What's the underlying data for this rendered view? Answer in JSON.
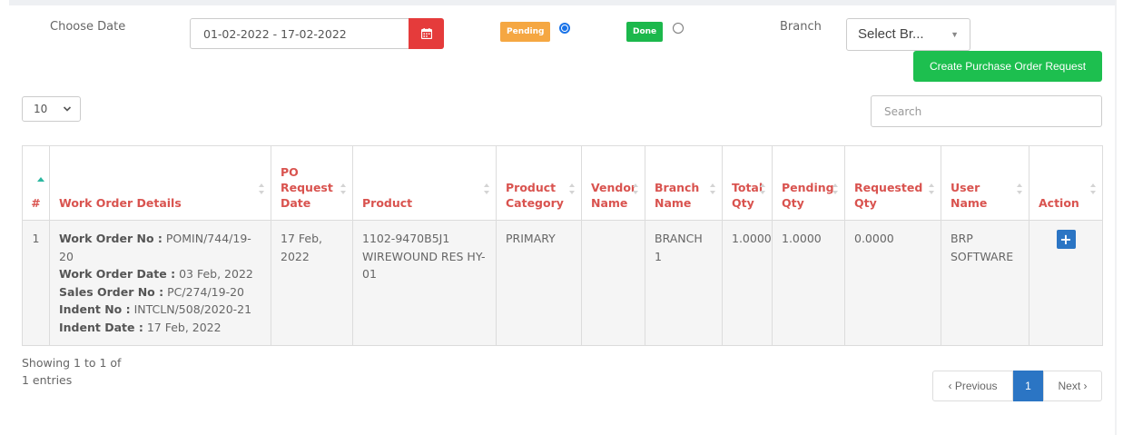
{
  "filters": {
    "date_label": "Choose Date",
    "date_range": "01-02-2022 - 17-02-2022",
    "pending_label": "Pending",
    "done_label": "Done",
    "branch_label": "Branch",
    "branch_select": "Select Br..."
  },
  "actions": {
    "create_po": "Create Purchase Order Request"
  },
  "list": {
    "page_size": "10",
    "search_placeholder": "Search"
  },
  "table": {
    "headers": {
      "idx": "#",
      "work_order_details": "Work Order Details",
      "po_request_date": "PO Request Date",
      "product": "Product",
      "product_category": "Product Category",
      "vendor_name": "Vendor Name",
      "branch_name": "Branch Name",
      "total_qty": "Total Qty",
      "pending_qty": "Pending Qty",
      "requested_qty": "Requested Qty",
      "user_name": "User Name",
      "action": "Action"
    },
    "rows": [
      {
        "idx": "1",
        "work_order_no_label": "Work Order No :",
        "work_order_no": "POMIN/744/19-20",
        "work_order_date_label": "Work Order Date :",
        "work_order_date": "03 Feb, 2022",
        "sales_order_no_label": "Sales Order No :",
        "sales_order_no": "PC/274/19-20",
        "indent_no_label": "Indent No :",
        "indent_no": "INTCLN/508/2020-21",
        "indent_date_label": "Indent Date :",
        "indent_date": "17 Feb, 2022",
        "po_request_date": "17 Feb, 2022",
        "product": "1102-9470B5J1 WIREWOUND RES HY-01",
        "product_category": "PRIMARY",
        "vendor_name": "",
        "branch_name": "BRANCH 1",
        "total_qty": "1.0000",
        "pending_qty": "1.0000",
        "requested_qty": "0.0000",
        "user_name": "BRP SOFTWARE",
        "action_label": "+"
      }
    ]
  },
  "footer": {
    "showing": "Showing 1 to 1 of 1 entries",
    "prev": "‹ Previous",
    "page": "1",
    "next": "Next ›"
  },
  "colors": {
    "header_text": "#d9534f",
    "pending": "#f5a742",
    "done": "#1cb84c",
    "calendar": "#e53b3b",
    "create_button": "#1dbf4f",
    "primary": "#2b75c4"
  },
  "icons": {
    "calendar": "calendar-icon",
    "sort": "sort-icon",
    "sort_asc": "sort-asc-icon",
    "chevron": "chevron-down-icon",
    "add": "plus-icon"
  }
}
